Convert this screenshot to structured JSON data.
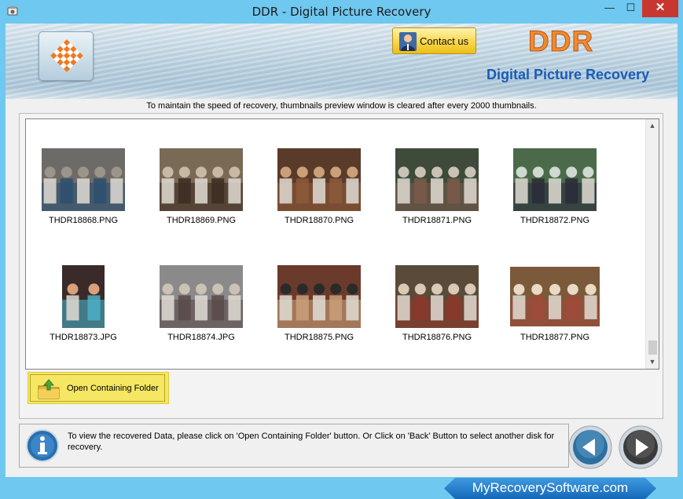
{
  "window": {
    "title": "DDR - Digital Picture Recovery",
    "controls": {
      "minimize": "—",
      "maximize": "☐",
      "close": "✕"
    }
  },
  "header": {
    "contact_label": "Contact us",
    "brand": "DDR",
    "product_name": "Digital Picture Recovery"
  },
  "notice": "To maintain the speed of recovery, thumbnails preview window is cleared after every 2000 thumbnails.",
  "thumbnails": [
    {
      "name": "THDR18868.PNG",
      "icon": "photo-people-sitting-steps"
    },
    {
      "name": "THDR18869.PNG",
      "icon": "photo-friends-outdoor"
    },
    {
      "name": "THDR18870.PNG",
      "icon": "photo-group-indoor"
    },
    {
      "name": "THDR18871.PNG",
      "icon": "photo-party-crowd"
    },
    {
      "name": "THDR18872.PNG",
      "icon": "photo-outdoor-gathering"
    },
    {
      "name": "THDR18873.JPG",
      "icon": "photo-child-portrait"
    },
    {
      "name": "THDR18874.JPG",
      "icon": "photo-hall-crowd"
    },
    {
      "name": "THDR18875.PNG",
      "icon": "photo-group-pose"
    },
    {
      "name": "THDR18876.PNG",
      "icon": "photo-table-gathering"
    },
    {
      "name": "THDR18877.PNG",
      "icon": "photo-dinner-party"
    }
  ],
  "open_folder_label": "Open Containing Folder",
  "status_message": "To view the recovered Data, please click on 'Open Containing Folder' button. Or Click on 'Back' Button to select another disk for recovery.",
  "footer": "MyRecoverySoftware.com",
  "colors": {
    "accent_orange": "#f08a2c",
    "brand_blue": "#1a5cb6",
    "button_yellow": "#f5e663",
    "titlebar": "#6ec8f0",
    "close_red": "#c7372f"
  }
}
